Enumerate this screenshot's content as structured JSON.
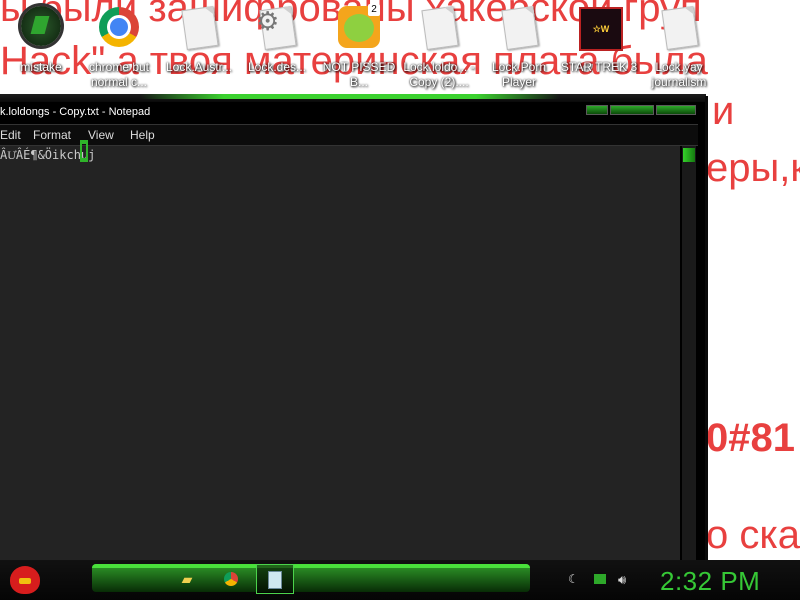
{
  "wallpaper": {
    "lines": [
      "ы были зашифрованы хакерской груп",
      "Hack\" а твоя материнская плата была",
      "и",
      "еры,к",
      "0#81",
      "о ска"
    ]
  },
  "desktop_icons": [
    {
      "label": "mistake",
      "icon": "app-circle-icon"
    },
    {
      "label": "chrome but normal c...",
      "icon": "chrome-icon"
    },
    {
      "label": "Lock.Austr...",
      "icon": "document-icon"
    },
    {
      "label": "Lock.des...",
      "icon": "settings-document-icon"
    },
    {
      "label": "NOT PISSED B...",
      "icon": "bad-piggies-icon",
      "badge": "2"
    },
    {
      "label": "Lock.loldo... - Copy (2)....",
      "icon": "text-document-icon"
    },
    {
      "label": "Lock.Porn Player",
      "icon": "document-icon"
    },
    {
      "label": "STAR TREK 3",
      "icon": "star-wars-game-icon"
    },
    {
      "label": "Lock.yay journalism",
      "icon": "document-icon"
    }
  ],
  "notepad": {
    "title": "k.loldongs - Copy.txt - Notepad",
    "menu": [
      "Edit",
      "Format",
      "View",
      "Help"
    ],
    "content": "ÂU҆ÂÉ¶&Öikchuj"
  },
  "taskbar": {
    "clock": "2:32 PM",
    "pinned": [
      "folder-icon",
      "chrome-icon",
      "notepad-icon"
    ]
  },
  "colors": {
    "wallpaper_text": "#e8403f",
    "accent_green": "#36c836",
    "editor_bg": "#232323"
  }
}
